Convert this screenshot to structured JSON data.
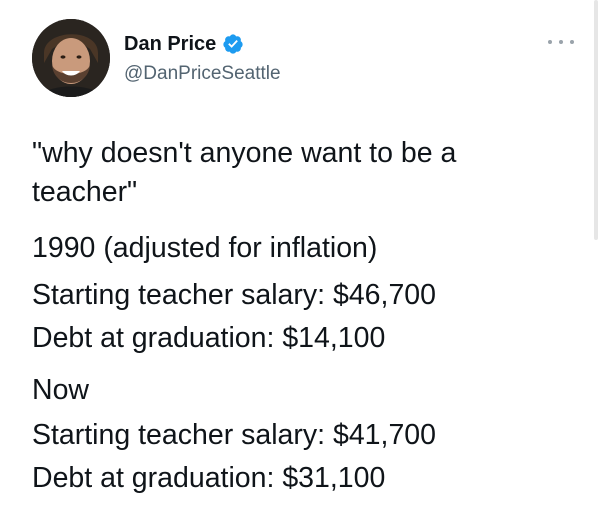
{
  "author": {
    "display_name": "Dan Price",
    "handle": "@DanPriceSeattle",
    "verified": true,
    "verified_color": "#1d9bf0"
  },
  "menu": {
    "icon": "more-horizontal-icon"
  },
  "tweet": {
    "lines": [
      "\"why doesn't anyone want to be a",
      "teacher\"",
      "1990 (adjusted for inflation)",
      "Starting teacher salary: $46,700",
      "Debt at graduation: $14,100",
      "Now",
      "Starting teacher salary: $41,700",
      "Debt at graduation: $31,100"
    ]
  }
}
